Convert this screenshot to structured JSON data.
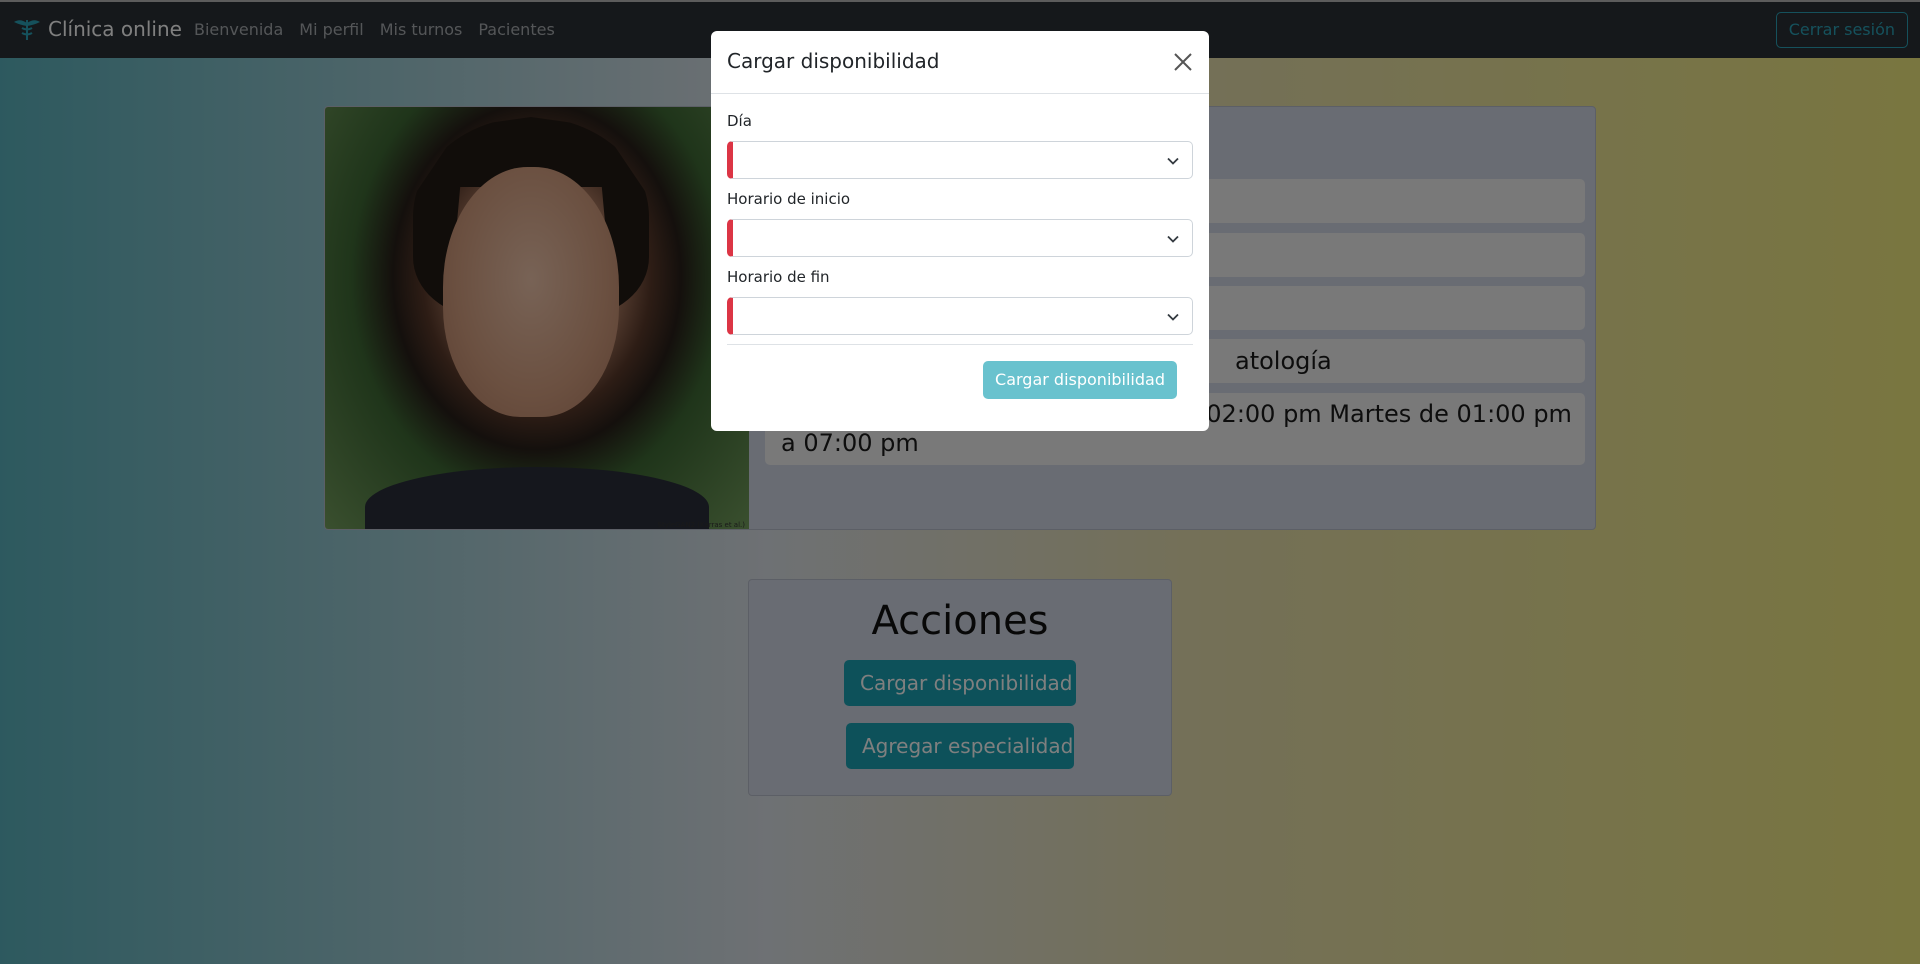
{
  "navbar": {
    "brand": "Clínica online",
    "brand_icon": "caduceus-icon",
    "links": [
      "Bienvenida",
      "Mi perfil",
      "Mis turnos",
      "Pacientes"
    ],
    "logout": "Cerrar sesión"
  },
  "profile": {
    "photo_credit": "StyleGAN2 (Karras et al.)",
    "rows": [
      "",
      "",
      "",
      "atología",
      "a 12:00 pm Sábado de 09:00 am a 02:00 pm Martes de 01:00 pm a 07:00 pm"
    ]
  },
  "actions": {
    "title": "Acciones",
    "load_availability": "Cargar disponibilidad",
    "add_specialty": "Agregar especialidad"
  },
  "modal": {
    "title": "Cargar disponibilidad",
    "fields": {
      "day_label": "Día",
      "day_value": "",
      "start_label": "Horario de inicio",
      "start_value": "",
      "end_label": "Horario de fin",
      "end_value": ""
    },
    "submit": "Cargar disponibilidad"
  },
  "colors": {
    "accent": "#1aa3b4",
    "invalid": "#dc3545",
    "navbar": "#2b3137"
  }
}
